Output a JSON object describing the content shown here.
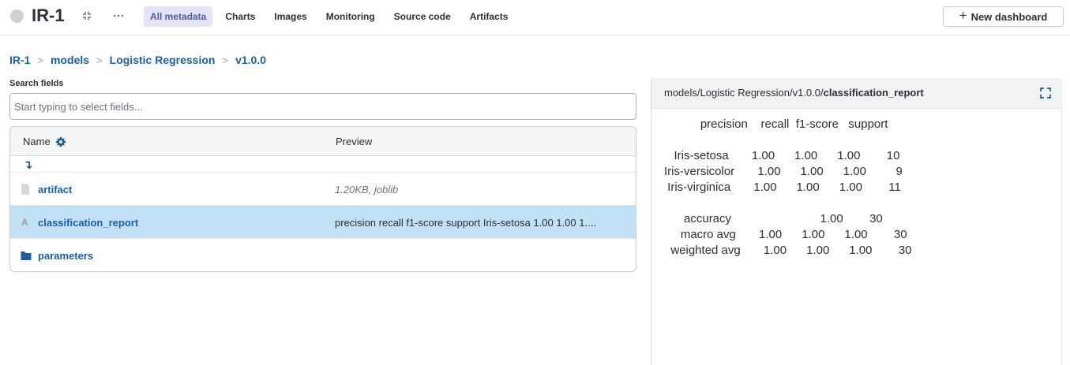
{
  "header": {
    "run_title": "IR-1",
    "tabs": [
      {
        "label": "All metadata",
        "active": true
      },
      {
        "label": "Charts",
        "active": false
      },
      {
        "label": "Images",
        "active": false
      },
      {
        "label": "Monitoring",
        "active": false
      },
      {
        "label": "Source code",
        "active": false
      },
      {
        "label": "Artifacts",
        "active": false
      }
    ],
    "new_dashboard_label": "New dashboard"
  },
  "breadcrumb": [
    "IR-1",
    "models",
    "Logistic Regression",
    "v1.0.0"
  ],
  "search": {
    "label": "Search fields",
    "placeholder": "Start typing to select fields...",
    "value": ""
  },
  "table": {
    "col_name": "Name",
    "col_preview": "Preview",
    "rows": [
      {
        "name": "artifact",
        "icon": "file-icon",
        "preview": "1.20KB, joblib"
      },
      {
        "name": "classification_report",
        "icon": "string-icon",
        "preview": "precision recall f1-score support Iris-setosa 1.00 1.00 1...."
      },
      {
        "name": "parameters",
        "icon": "folder-icon",
        "preview": ""
      }
    ]
  },
  "panel": {
    "path_prefix": "models/Logistic Regression/v1.0.0/",
    "path_field": "classification_report",
    "report_text": "           precision    recall  f1-score   support\n\n   Iris-setosa       1.00      1.00      1.00        10\nIris-versicolor       1.00      1.00      1.00         9\n Iris-virginica       1.00      1.00      1.00        11\n\n      accuracy                           1.00        30\n     macro avg       1.00      1.00      1.00        30\n  weighted avg       1.00      1.00      1.00        30"
  },
  "colors": {
    "accent": "#1a5fa6",
    "active_tab_bg": "#e3e4f7",
    "selected_row": "#c2e0f6"
  }
}
